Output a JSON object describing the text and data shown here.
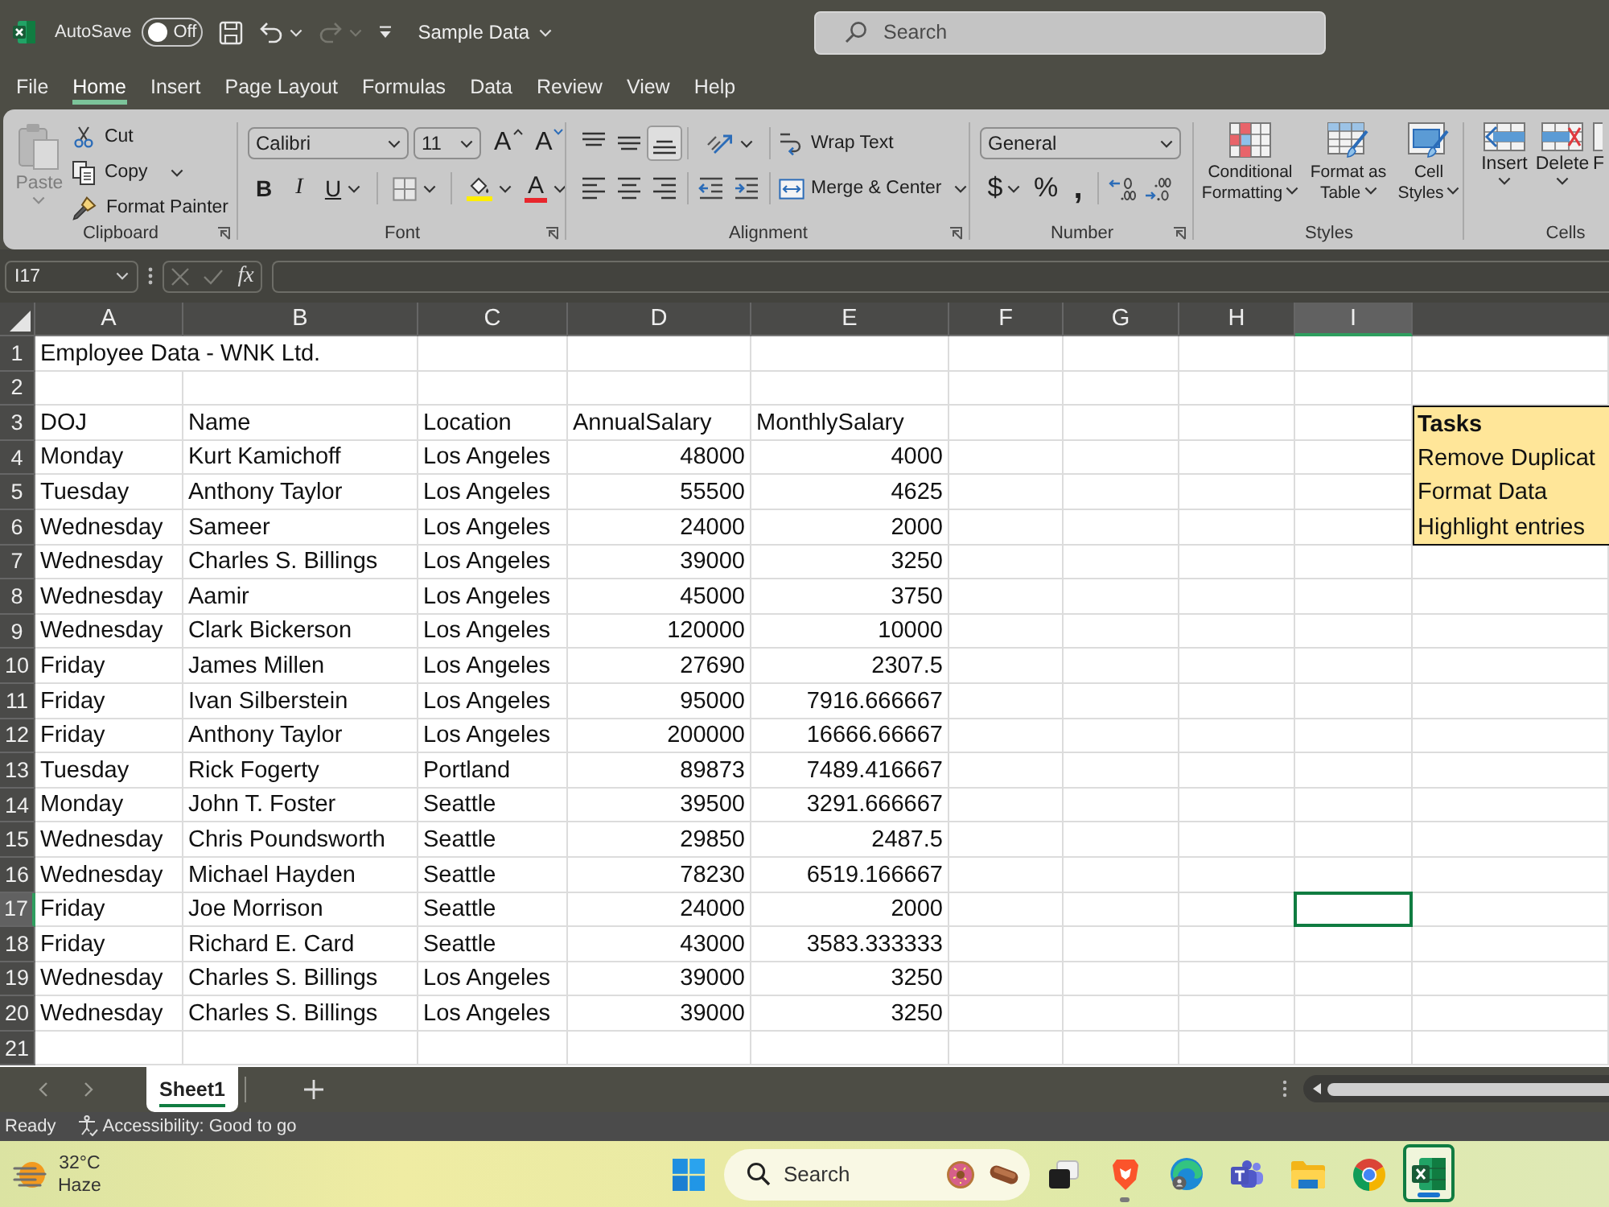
{
  "title_bar": {
    "autosave": {
      "label": "AutoSave",
      "on": false,
      "state_label": "Off"
    },
    "quick_access": [
      {
        "kind": "save",
        "disabled": false
      },
      {
        "kind": "undo",
        "disabled": false
      },
      {
        "kind": "redo",
        "disabled": true
      },
      {
        "kind": "customize",
        "disabled": false
      }
    ],
    "document_title": "Sample Data",
    "search": {
      "placeholder": "Search"
    }
  },
  "menu_tabs": [
    {
      "label": "File",
      "selected": false
    },
    {
      "label": "Home",
      "selected": true
    },
    {
      "label": "Insert",
      "selected": false
    },
    {
      "label": "Page Layout",
      "selected": false
    },
    {
      "label": "Formulas",
      "selected": false
    },
    {
      "label": "Data",
      "selected": false
    },
    {
      "label": "Review",
      "selected": false
    },
    {
      "label": "View",
      "selected": false
    },
    {
      "label": "Help",
      "selected": false
    }
  ],
  "ribbon": {
    "groups": [
      {
        "kind": "clipboard",
        "label": "Clipboard",
        "launcher": true,
        "paste": {
          "label": "Paste",
          "disabled": true
        },
        "commands": [
          {
            "kind": "cut",
            "label": "Cut"
          },
          {
            "kind": "copy",
            "label": "Copy"
          },
          {
            "kind": "format-painter",
            "label": "Format Painter"
          }
        ]
      },
      {
        "kind": "font",
        "label": "Font",
        "launcher": true,
        "font_name": "Calibri",
        "font_size": "11",
        "size_buttons": [
          {
            "kind": "grow",
            "label": "A"
          },
          {
            "kind": "shrink",
            "label": "A"
          }
        ],
        "style_buttons": [
          {
            "kind": "bold",
            "label": "B"
          },
          {
            "kind": "italic",
            "label": "I"
          },
          {
            "kind": "underline",
            "label": "U"
          }
        ],
        "font_color": "A"
      },
      {
        "kind": "alignment",
        "label": "Alignment",
        "launcher": true,
        "vertical_align": [
          {
            "kind": "top",
            "selected": false
          },
          {
            "kind": "middle",
            "selected": false
          },
          {
            "kind": "bottom",
            "selected": true
          }
        ],
        "horizontal_align": [
          {
            "kind": "left",
            "selected": false
          },
          {
            "kind": "center",
            "selected": false
          },
          {
            "kind": "right",
            "selected": false
          }
        ],
        "wrap_text": "Wrap Text",
        "merge": "Merge & Center"
      },
      {
        "kind": "number",
        "label": "Number",
        "launcher": true,
        "format": "General",
        "buttons": [
          {
            "kind": "currency",
            "label": "$"
          },
          {
            "kind": "percent",
            "label": "%"
          },
          {
            "kind": "comma",
            "label": ","
          }
        ]
      },
      {
        "kind": "styles",
        "label": "Styles",
        "launcher": false,
        "commands": [
          {
            "kind": "conditional",
            "label": "Conditional Formatting"
          },
          {
            "kind": "table",
            "label": "Format as Table"
          },
          {
            "kind": "cell-styles",
            "label": "Cell Styles"
          }
        ]
      },
      {
        "kind": "cells",
        "label": "Cells",
        "launcher": false,
        "commands": [
          {
            "kind": "insert",
            "label": "Insert"
          },
          {
            "kind": "delete",
            "label": "Delete"
          },
          {
            "kind": "format",
            "label": "F"
          }
        ]
      }
    ]
  },
  "formula_bar": {
    "name_box": "I17",
    "insert_function": "fx"
  },
  "sheet": {
    "columns": [
      {
        "label": "A",
        "selected": false
      },
      {
        "label": "B",
        "selected": false
      },
      {
        "label": "C",
        "selected": false
      },
      {
        "label": "D",
        "selected": false
      },
      {
        "label": "E",
        "selected": false
      },
      {
        "label": "F",
        "selected": false
      },
      {
        "label": "G",
        "selected": false
      },
      {
        "label": "H",
        "selected": false
      },
      {
        "label": "I",
        "selected": true
      }
    ],
    "rows": [
      {
        "number": "1",
        "selected": false,
        "cells": [
          {
            "kind": "title",
            "text": "Employee Data - WNK Ltd."
          }
        ]
      },
      {
        "number": "2",
        "selected": false
      },
      {
        "number": "3",
        "selected": false,
        "cells": [
          {
            "kind": "text",
            "text": "DOJ"
          },
          {
            "kind": "text",
            "text": "Name"
          },
          {
            "kind": "text",
            "text": "Location"
          },
          {
            "kind": "text",
            "text": "AnnualSalary"
          },
          {
            "kind": "text",
            "text": "MonthlySalary"
          }
        ]
      },
      {
        "number": "4",
        "selected": false,
        "cells": [
          {
            "kind": "text",
            "text": "Monday"
          },
          {
            "kind": "text",
            "text": "Kurt Kamichoff"
          },
          {
            "kind": "text",
            "text": "Los Angeles"
          },
          {
            "kind": "number",
            "text": "48000"
          },
          {
            "kind": "number",
            "text": "4000"
          }
        ]
      },
      {
        "number": "5",
        "selected": false,
        "cells": [
          {
            "kind": "text",
            "text": "Tuesday"
          },
          {
            "kind": "text",
            "text": "Anthony Taylor"
          },
          {
            "kind": "text",
            "text": "Los Angeles"
          },
          {
            "kind": "number",
            "text": "55500"
          },
          {
            "kind": "number",
            "text": "4625"
          }
        ]
      },
      {
        "number": "6",
        "selected": false,
        "cells": [
          {
            "kind": "text",
            "text": "Wednesday"
          },
          {
            "kind": "text",
            "text": "Sameer"
          },
          {
            "kind": "text",
            "text": "Los Angeles"
          },
          {
            "kind": "number",
            "text": "24000"
          },
          {
            "kind": "number",
            "text": "2000"
          }
        ]
      },
      {
        "number": "7",
        "selected": false,
        "cells": [
          {
            "kind": "text",
            "text": "Wednesday"
          },
          {
            "kind": "text",
            "text": "Charles S. Billings"
          },
          {
            "kind": "text",
            "text": "Los Angeles"
          },
          {
            "kind": "number",
            "text": "39000"
          },
          {
            "kind": "number",
            "text": "3250"
          }
        ]
      },
      {
        "number": "8",
        "selected": false,
        "cells": [
          {
            "kind": "text",
            "text": "Wednesday"
          },
          {
            "kind": "text",
            "text": "Aamir"
          },
          {
            "kind": "text",
            "text": "Los Angeles"
          },
          {
            "kind": "number",
            "text": "45000"
          },
          {
            "kind": "number",
            "text": "3750"
          }
        ]
      },
      {
        "number": "9",
        "selected": false,
        "cells": [
          {
            "kind": "text",
            "text": "Wednesday"
          },
          {
            "kind": "text",
            "text": "Clark Bickerson"
          },
          {
            "kind": "text",
            "text": "Los Angeles"
          },
          {
            "kind": "number",
            "text": "120000"
          },
          {
            "kind": "number",
            "text": "10000"
          }
        ]
      },
      {
        "number": "10",
        "selected": false,
        "cells": [
          {
            "kind": "text",
            "text": "Friday"
          },
          {
            "kind": "text",
            "text": "James Millen"
          },
          {
            "kind": "text",
            "text": "Los Angeles"
          },
          {
            "kind": "number",
            "text": "27690"
          },
          {
            "kind": "number",
            "text": "2307.5"
          }
        ]
      },
      {
        "number": "11",
        "selected": false,
        "cells": [
          {
            "kind": "text",
            "text": "Friday"
          },
          {
            "kind": "text",
            "text": "Ivan Silberstein"
          },
          {
            "kind": "text",
            "text": "Los Angeles"
          },
          {
            "kind": "number",
            "text": "95000"
          },
          {
            "kind": "number",
            "text": "7916.666667"
          }
        ]
      },
      {
        "number": "12",
        "selected": false,
        "cells": [
          {
            "kind": "text",
            "text": "Friday"
          },
          {
            "kind": "text",
            "text": "Anthony Taylor"
          },
          {
            "kind": "text",
            "text": "Los Angeles"
          },
          {
            "kind": "number",
            "text": "200000"
          },
          {
            "kind": "number",
            "text": "16666.66667"
          }
        ]
      },
      {
        "number": "13",
        "selected": false,
        "cells": [
          {
            "kind": "text",
            "text": "Tuesday"
          },
          {
            "kind": "text",
            "text": "Rick Fogerty"
          },
          {
            "kind": "text",
            "text": "Portland"
          },
          {
            "kind": "number",
            "text": "89873"
          },
          {
            "kind": "number",
            "text": "7489.416667"
          }
        ]
      },
      {
        "number": "14",
        "selected": false,
        "cells": [
          {
            "kind": "text",
            "text": "Monday"
          },
          {
            "kind": "text",
            "text": "John T. Foster"
          },
          {
            "kind": "text",
            "text": "Seattle"
          },
          {
            "kind": "number",
            "text": "39500"
          },
          {
            "kind": "number",
            "text": "3291.666667"
          }
        ]
      },
      {
        "number": "15",
        "selected": false,
        "cells": [
          {
            "kind": "text",
            "text": "Wednesday"
          },
          {
            "kind": "text",
            "text": "Chris Poundsworth"
          },
          {
            "kind": "text",
            "text": "Seattle"
          },
          {
            "kind": "number",
            "text": "29850"
          },
          {
            "kind": "number",
            "text": "2487.5"
          }
        ]
      },
      {
        "number": "16",
        "selected": false,
        "cells": [
          {
            "kind": "text",
            "text": "Wednesday"
          },
          {
            "kind": "text",
            "text": "Michael Hayden"
          },
          {
            "kind": "text",
            "text": "Seattle"
          },
          {
            "kind": "number",
            "text": "78230"
          },
          {
            "kind": "number",
            "text": "6519.166667"
          }
        ]
      },
      {
        "number": "17",
        "selected": true,
        "cells": [
          {
            "kind": "text",
            "text": "Friday"
          },
          {
            "kind": "text",
            "text": "Joe Morrison"
          },
          {
            "kind": "text",
            "text": "Seattle"
          },
          {
            "kind": "number",
            "text": "24000"
          },
          {
            "kind": "number",
            "text": "2000"
          }
        ]
      },
      {
        "number": "18",
        "selected": false,
        "cells": [
          {
            "kind": "text",
            "text": "Friday"
          },
          {
            "kind": "text",
            "text": "Richard E. Card"
          },
          {
            "kind": "text",
            "text": "Seattle"
          },
          {
            "kind": "number",
            "text": "43000"
          },
          {
            "kind": "number",
            "text": "3583.333333"
          }
        ]
      },
      {
        "number": "19",
        "selected": false,
        "cells": [
          {
            "kind": "text",
            "text": "Wednesday"
          },
          {
            "kind": "text",
            "text": "Charles S. Billings"
          },
          {
            "kind": "text",
            "text": "Los Angeles"
          },
          {
            "kind": "number",
            "text": "39000"
          },
          {
            "kind": "number",
            "text": "3250"
          }
        ]
      },
      {
        "number": "20",
        "selected": false,
        "cells": [
          {
            "kind": "text",
            "text": "Wednesday"
          },
          {
            "kind": "text",
            "text": "Charles S. Billings"
          },
          {
            "kind": "text",
            "text": "Los Angeles"
          },
          {
            "kind": "number",
            "text": "39000"
          },
          {
            "kind": "number",
            "text": "3250"
          }
        ]
      },
      {
        "number": "21",
        "selected": false
      }
    ],
    "task_box": {
      "title": "Tasks",
      "lines": [
        "Remove Duplicat",
        "Format Data",
        "Highlight entries"
      ]
    }
  },
  "sheet_tabs": [
    {
      "label": "Sheet1",
      "selected": true
    }
  ],
  "status_bar": {
    "status": "Ready",
    "accessibility": "Accessibility: Good to go"
  },
  "taskbar": {
    "weather": {
      "temperature": "32°C",
      "condition": "Haze"
    },
    "search": {
      "placeholder": "Search"
    },
    "apps": [
      {
        "kind": "task-view",
        "running": false,
        "active": false
      },
      {
        "kind": "brave",
        "running": true,
        "active": false
      },
      {
        "kind": "edge",
        "running": false,
        "active": false
      },
      {
        "kind": "teams",
        "running": false,
        "active": false
      },
      {
        "kind": "explorer",
        "running": false,
        "active": false
      },
      {
        "kind": "chrome",
        "running": false,
        "active": false
      },
      {
        "kind": "excel",
        "running": true,
        "active": true
      }
    ]
  }
}
